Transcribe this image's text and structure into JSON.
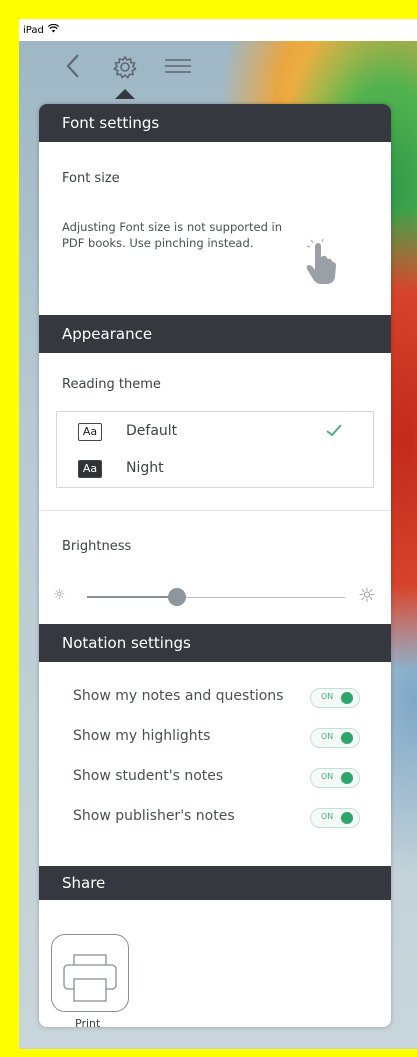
{
  "status_bar": {
    "device": "iPad",
    "wifi_icon": "wifi-icon"
  },
  "nav": {
    "back_icon": "chevron-left-icon",
    "settings_icon": "gear-icon",
    "menu_icon": "hamburger-menu-icon"
  },
  "font_settings": {
    "header": "Font settings",
    "font_size_label": "Font size",
    "note_line1": "Adjusting Font size is not supported in",
    "note_line2": "PDF books. Use pinching instead.",
    "pinch_icon": "pinch-hand-icon"
  },
  "appearance": {
    "header": "Appearance",
    "reading_theme_label": "Reading theme",
    "themes": [
      {
        "icon_text": "Aa",
        "name": "Default",
        "selected": true
      },
      {
        "icon_text": "Aa",
        "name": "Night",
        "selected": false
      }
    ],
    "brightness_label": "Brightness",
    "brightness_level": 0.35
  },
  "notation_settings": {
    "header": "Notation settings",
    "items": [
      {
        "label": "Show my notes and questions",
        "toggle": "ON"
      },
      {
        "label": "Show my highlights",
        "toggle": "ON"
      },
      {
        "label": "Show student's notes",
        "toggle": "ON"
      },
      {
        "label": "Show publisher's notes",
        "toggle": "ON"
      }
    ]
  },
  "share": {
    "header": "Share",
    "print_label": "Print",
    "print_icon": "printer-icon"
  },
  "colors": {
    "header_bg": "#35393f",
    "accent_green": "#2ea56a",
    "frame": "#ffff00"
  }
}
